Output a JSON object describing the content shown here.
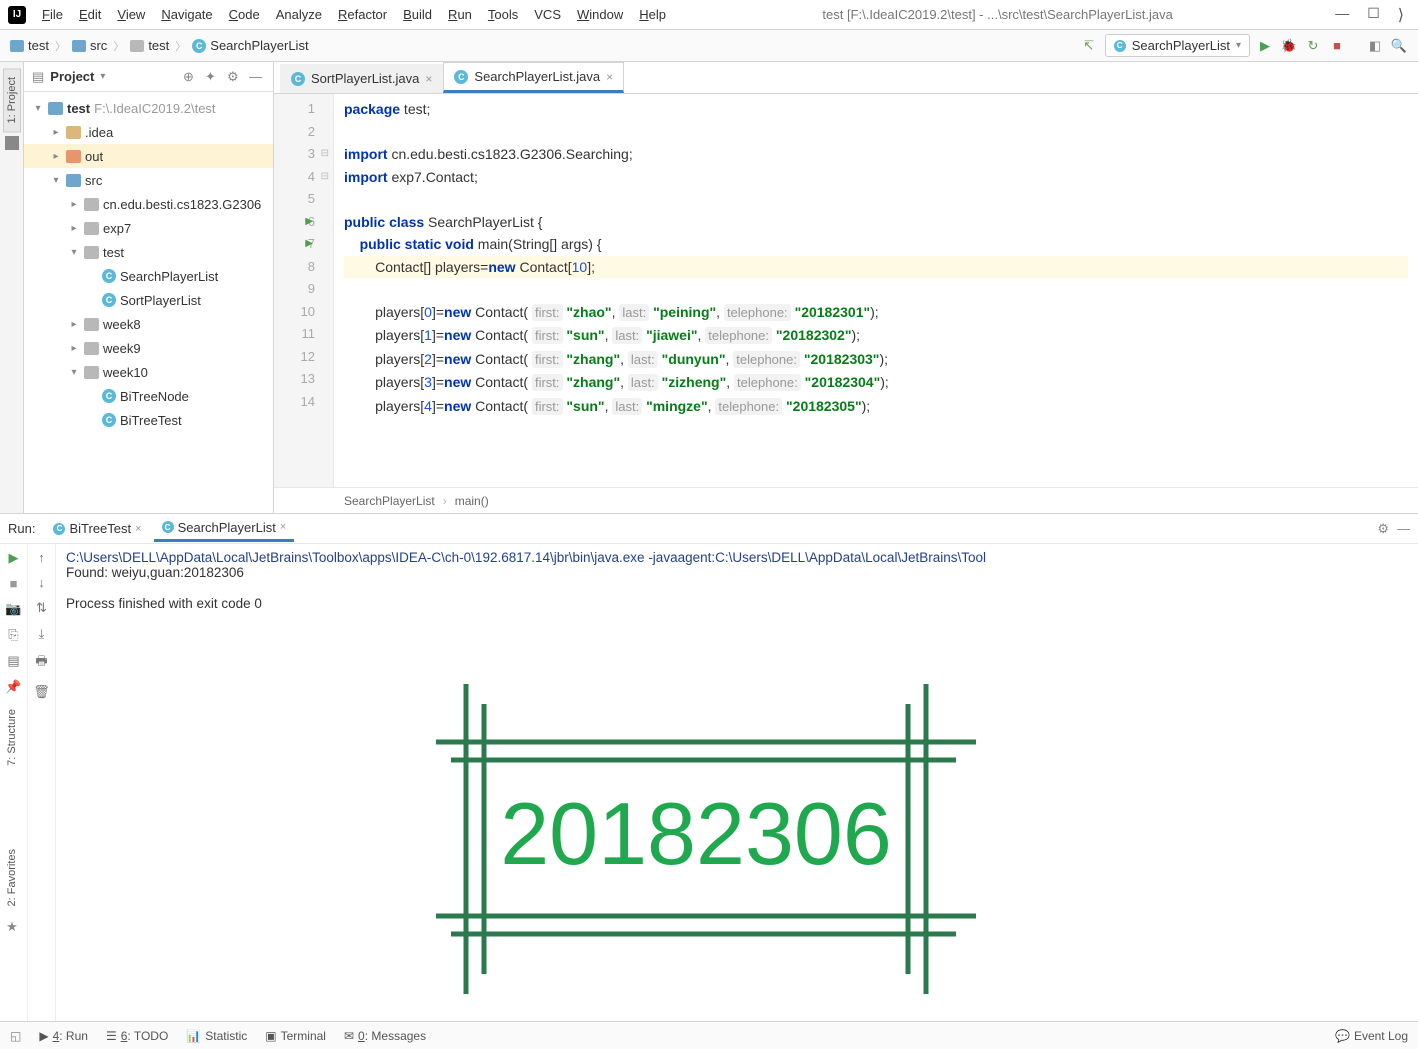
{
  "menu": [
    "File",
    "Edit",
    "View",
    "Navigate",
    "Code",
    "Analyze",
    "Refactor",
    "Build",
    "Run",
    "Tools",
    "VCS",
    "Window",
    "Help"
  ],
  "menu_accel": [
    "F",
    "E",
    "V",
    "N",
    "C",
    "",
    "R",
    "B",
    "R",
    "T",
    "",
    "W",
    "H"
  ],
  "title_path": "test [F:\\.IdeaIC2019.2\\test] - ...\\src\\test\\SearchPlayerList.java",
  "breadcrumb": [
    {
      "icon": "folder-b",
      "label": "test"
    },
    {
      "icon": "folder-b",
      "label": "src"
    },
    {
      "icon": "folder-g",
      "label": "test"
    },
    {
      "icon": "class",
      "label": "SearchPlayerList"
    }
  ],
  "run_config_selected": "SearchPlayerList",
  "project_label": "Project",
  "tree": [
    {
      "d": 0,
      "tw": "▾",
      "ic": "folder-b",
      "label": "test",
      "suffix": " F:\\.IdeaIC2019.2\\test",
      "bold": true
    },
    {
      "d": 1,
      "tw": "▸",
      "ic": "folder-y",
      "label": ".idea"
    },
    {
      "d": 1,
      "tw": "▸",
      "ic": "folder-o",
      "label": "out",
      "sel": true
    },
    {
      "d": 1,
      "tw": "▾",
      "ic": "folder-b",
      "label": "src"
    },
    {
      "d": 2,
      "tw": "▸",
      "ic": "folder-g",
      "label": "cn.edu.besti.cs1823.G2306"
    },
    {
      "d": 2,
      "tw": "▸",
      "ic": "folder-g",
      "label": "exp7"
    },
    {
      "d": 2,
      "tw": "▾",
      "ic": "folder-g",
      "label": "test"
    },
    {
      "d": 3,
      "tw": "",
      "ic": "class",
      "label": "SearchPlayerList"
    },
    {
      "d": 3,
      "tw": "",
      "ic": "class",
      "label": "SortPlayerList"
    },
    {
      "d": 2,
      "tw": "▸",
      "ic": "folder-g",
      "label": "week8"
    },
    {
      "d": 2,
      "tw": "▸",
      "ic": "folder-g",
      "label": "week9"
    },
    {
      "d": 2,
      "tw": "▾",
      "ic": "folder-g",
      "label": "week10"
    },
    {
      "d": 3,
      "tw": "",
      "ic": "class",
      "label": "BiTreeNode"
    },
    {
      "d": 3,
      "tw": "",
      "ic": "class",
      "label": "BiTreeTest"
    }
  ],
  "tabs": [
    {
      "label": "SortPlayerList.java",
      "active": false
    },
    {
      "label": "SearchPlayerList.java",
      "active": true
    }
  ],
  "code_lines": [
    1,
    2,
    3,
    4,
    5,
    6,
    7,
    8,
    9,
    10,
    11,
    12,
    13,
    14
  ],
  "code": {
    "l1": "package test;",
    "l3_import": "import",
    "l3_rest": " cn.edu.besti.cs1823.G2306.Searching;",
    "l4_import": "import",
    "l4_rest": " exp7.Contact;",
    "l6": "public class SearchPlayerList {",
    "l7": "    public static void main(String[] args) {",
    "l8": "        Contact[] players=new Contact[10];",
    "rows": [
      {
        "idx": "0",
        "first": "zhao",
        "last": "peining",
        "tel": "20182301"
      },
      {
        "idx": "1",
        "first": "sun",
        "last": "jiawei",
        "tel": "20182302"
      },
      {
        "idx": "2",
        "first": "zhang",
        "last": "dunyun",
        "tel": "20182303"
      },
      {
        "idx": "3",
        "first": "zhang",
        "last": "zizheng",
        "tel": "20182304"
      },
      {
        "idx": "4",
        "first": "sun",
        "last": "mingze",
        "tel": "20182305"
      }
    ]
  },
  "crumb_bar": [
    "SearchPlayerList",
    "main()"
  ],
  "run_label": "Run:",
  "run_tabs": [
    {
      "label": "BiTreeTest",
      "active": false
    },
    {
      "label": "SearchPlayerList",
      "active": true
    }
  ],
  "console": {
    "cmd": "C:\\Users\\DELL\\AppData\\Local\\JetBrains\\Toolbox\\apps\\IDEA-C\\ch-0\\192.6817.14\\jbr\\bin\\java.exe -javaagent:C:\\Users\\DELL\\AppData\\Local\\JetBrains\\Tool",
    "out1": "Found: weiyu,guan:20182306",
    "out2": "Process finished with exit code 0"
  },
  "watermark_text": "20182306",
  "status": [
    {
      "ic": "run",
      "label": "4: Run",
      "u": "4"
    },
    {
      "ic": "todo",
      "label": "6: TODO",
      "u": "6"
    },
    {
      "ic": "stat",
      "label": "Statistic"
    },
    {
      "ic": "term",
      "label": "Terminal"
    },
    {
      "ic": "msg",
      "label": "0: Messages",
      "u": "0"
    }
  ],
  "event_log": "Event Log",
  "left_tabs": {
    "project": "1: Project",
    "structure": "7: Structure",
    "favorites": "2: Favorites"
  }
}
